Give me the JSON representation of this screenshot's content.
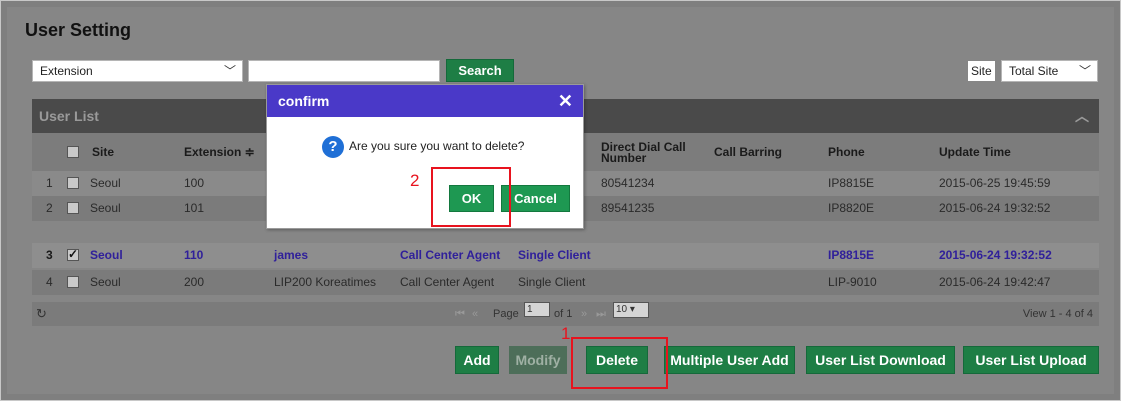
{
  "page": {
    "title": "User Setting"
  },
  "filter": {
    "field_select": "Extension",
    "search_value": "",
    "search_button": "Search",
    "site_label": "Site",
    "site_select": "Total Site"
  },
  "list": {
    "header": "User List",
    "columns": [
      "Site",
      "Extension ≑",
      "Direct Dial Call Number",
      "Call Barring",
      "Phone",
      "Update Time"
    ],
    "rows": [
      {
        "num": "1",
        "site": "Seoul",
        "ext": "100",
        "name": "",
        "role": "",
        "client": "",
        "ddi": "80541234",
        "phone": "IP8815E",
        "update": "2015-06-25 19:45:59",
        "checked": false
      },
      {
        "num": "2",
        "site": "Seoul",
        "ext": "101",
        "name": "",
        "role": "",
        "client": "",
        "ddi": "89541235",
        "phone": "IP8820E",
        "update": "2015-06-24 19:32:52",
        "checked": false
      },
      {
        "num": "3",
        "site": "Seoul",
        "ext": "110",
        "name": "james",
        "role": "Call Center Agent",
        "client": "Single Client",
        "ddi": "",
        "phone": "IP8815E",
        "update": "2015-06-24 19:32:52",
        "checked": true
      },
      {
        "num": "4",
        "site": "Seoul",
        "ext": "200",
        "name": "LIP200 Koreatimes",
        "role": "Call Center Agent",
        "client": "Single Client",
        "ddi": "",
        "phone": "LIP-9010",
        "update": "2015-06-24 19:42:47",
        "checked": false
      }
    ],
    "pager": {
      "page_label": "Page",
      "page_value": "1",
      "of_label": "of 1",
      "rows_value": "10",
      "view_text": "View 1 - 4 of 4"
    }
  },
  "actions": {
    "add": "Add",
    "modify": "Modify",
    "delete": "Delete",
    "multiple_add": "Multiple User Add",
    "download": "User List Download",
    "upload": "User List Upload"
  },
  "annotations": {
    "step1": "1",
    "step2": "2"
  },
  "dialog": {
    "title": "confirm",
    "close": "✕",
    "message": "Are you sure you want to delete?",
    "ok": "OK",
    "cancel": "Cancel"
  },
  "colors": {
    "accent_green": "#1e7e45",
    "dialog_title": "#4a39c8",
    "highlight_red": "#e8131e",
    "selected_text": "#30209a"
  }
}
